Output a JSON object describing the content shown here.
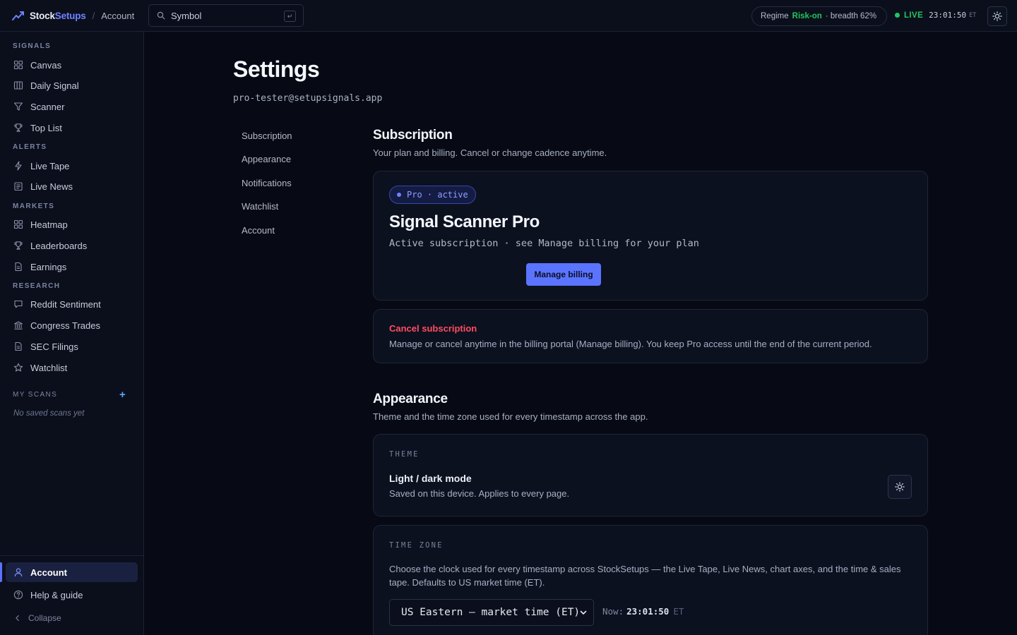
{
  "app": {
    "brand_prefix": "Stock",
    "brand_suffix": "Setups",
    "breadcrumb_sep": "/",
    "breadcrumb": "Account"
  },
  "search": {
    "placeholder": "Symbol",
    "shortcut": "↵"
  },
  "status": {
    "regime_label": "Regime",
    "regime_value": "Risk-on",
    "breadth": "· breadth 62%",
    "live_label": "LIVE",
    "clock": "23:01:50",
    "tz": "ET"
  },
  "sidebar": {
    "sections": {
      "signals": "SIGNALS",
      "alerts": "ALERTS",
      "markets": "MARKETS",
      "research": "RESEARCH",
      "my_scans": "MY SCANS"
    },
    "items": {
      "canvas": "Canvas",
      "daily_signal": "Daily Signal",
      "scanner": "Scanner",
      "top_list": "Top List",
      "live_tape": "Live Tape",
      "live_news": "Live News",
      "heatmap": "Heatmap",
      "leaderboards": "Leaderboards",
      "earnings": "Earnings",
      "reddit_sentiment": "Reddit Sentiment",
      "congress_trades": "Congress Trades",
      "sec_filings": "SEC Filings",
      "watchlist": "Watchlist"
    },
    "add_scan": "+",
    "no_scans": "No saved scans yet",
    "account": "Account",
    "help": "Help & guide",
    "collapse": "Collapse"
  },
  "page": {
    "title": "Settings",
    "email": "pro-tester@setupsignals.app"
  },
  "subnav": [
    "Subscription",
    "Appearance",
    "Notifications",
    "Watchlist",
    "Account"
  ],
  "subscription": {
    "heading": "Subscription",
    "description": "Your plan and billing. Cancel or change cadence anytime.",
    "badge": "Pro · active",
    "plan_name": "Signal Scanner Pro",
    "plan_status": "Active subscription · see Manage billing for your plan",
    "manage_button": "Manage billing",
    "cancel_title": "Cancel subscription",
    "cancel_text": "Manage or cancel anytime in the billing portal (Manage billing). You keep Pro access until the end of the current period."
  },
  "appearance": {
    "heading": "Appearance",
    "description": "Theme and the time zone used for every timestamp across the app.",
    "theme_label": "THEME",
    "theme_title": "Light / dark mode",
    "theme_sub": "Saved on this device. Applies to every page.",
    "tz_label": "TIME ZONE",
    "tz_desc": "Choose the clock used for every timestamp across StockSetups — the Live Tape, Live News, chart axes, and the time & sales tape. Defaults to US market time (ET).",
    "tz_selected": "US Eastern — market time (ET)",
    "now_label": "Now:",
    "now_time": "23:01:50",
    "now_tz": "ET"
  },
  "colors": {
    "accent": "#5b74ff",
    "live": "#22c55e",
    "danger": "#ff4d5e",
    "background": "#070a14"
  }
}
